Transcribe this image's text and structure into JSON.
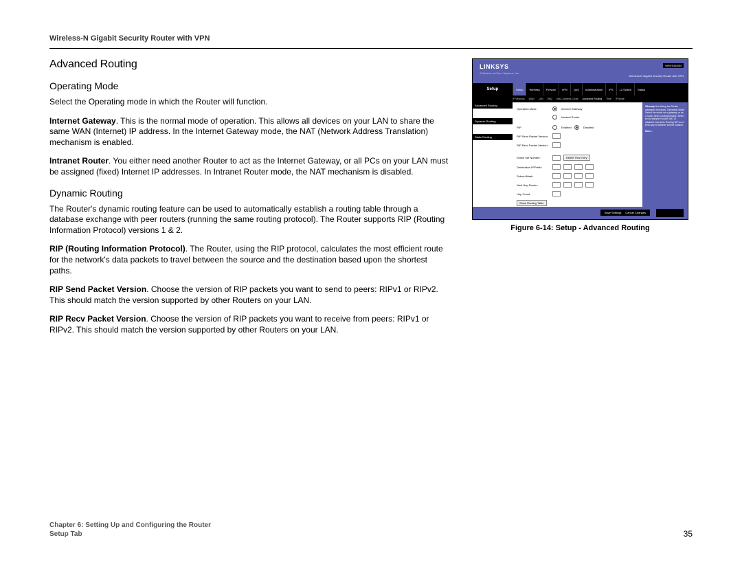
{
  "header": {
    "product_title": "Wireless-N Gigabit Security Router with VPN"
  },
  "main": {
    "section_title": "Advanced Routing",
    "sub1_title": "Operating Mode",
    "p1": "Select the Operating mode in which the Router will function.",
    "p2_bold": "Internet Gateway",
    "p2_text": ". This is the normal mode of operation. This allows all devices on your LAN to share the same WAN (Internet) IP address. In the Internet Gateway mode, the NAT (Network Address Translation) mechanism is enabled.",
    "p3_bold": "Intranet Router",
    "p3_text": ". You either need another Router to act as the Internet Gateway, or all PCs on your LAN must be assigned (fixed) Internet IP addresses. In Intranet Router mode, the NAT mechanism is disabled.",
    "sub2_title": "Dynamic Routing",
    "p4": "The Router's dynamic routing feature can be used to automatically establish a routing table through a database exchange with peer routers (running the same routing protocol). The Router supports RIP (Routing Information Protocol) versions 1 & 2.",
    "p5_bold": "RIP (Routing Information Protocol)",
    "p5_text": ". The Router, using the RIP protocol, calculates the most efficient route for the network's data packets to travel between the source and the destination based upon the shortest paths.",
    "p6_bold": "RIP Send Packet Version",
    "p6_text": ". Choose the version of RIP packets you want to send to peers: RIPv1 or RIPv2. This should match the version supported by other Routers on your LAN.",
    "p7_bold": "RIP Recv Packet Version",
    "p7_text": ". Choose the version of RIP packets you want to receive from peers: RIPv1 or RIPv2. This should match the version supported by other Routers on your LAN."
  },
  "figure": {
    "caption": "Figure 6-14: Setup - Advanced Routing",
    "logo": "LINKSYS",
    "logo_sub": "A Division of Cisco Systems, Inc.",
    "header_right": "Wireless-N Gigabit Security Router with VPN",
    "model": "WRVS4400N",
    "side_label": "Setup",
    "tabs": [
      "Setup",
      "Wireless",
      "Firewall",
      "VPN",
      "QoS",
      "Administration",
      "IPS",
      "L2 Switch",
      "Status"
    ],
    "subtabs": [
      "IP Versions",
      "WAN",
      "LAN",
      "DMZ",
      "MAC Address Clone",
      "Advanced Routing",
      "Time",
      "IP Mode"
    ],
    "left_nav": [
      "Advanced Routing",
      "Dynamic Routing",
      "Static Routing"
    ],
    "rows": {
      "op_mode": "Operation Mode",
      "op_mode_opt1": "Internet Gateway",
      "op_mode_opt2": "Intranet Router",
      "rip": "RIP",
      "rip_opt1": "Enabled",
      "rip_opt2": "Disabled",
      "rip_send": "RIP Send Packet Version:",
      "rip_recv": "RIP Recv Packet Version:",
      "select_set": "Select Set Number:",
      "delete_btn": "Delete This Entry",
      "dest_ip": "Destination IP/Prefix:",
      "subnet": "Subnet Mask:",
      "next_hop": "Next Hop Router:",
      "hop_count": "Hop Count:",
      "show_table": "Show Routing Table"
    },
    "help_title": "Sitemap",
    "help_text": "Use listing the Router advanced functions. Operation Mode Select the mode as a gateway or as a router when routing/hosting. When set to Intranet Router, NAT is disabled. Dynamic Routing RIP as a best way to another subnet location.",
    "help_more": "More...",
    "footer_btn1": "Save Settings",
    "footer_btn2": "Cancel Changes"
  },
  "footer": {
    "chapter": "Chapter 6: Setting Up and Configuring the Router",
    "tab": "Setup Tab",
    "page_number": "35"
  }
}
